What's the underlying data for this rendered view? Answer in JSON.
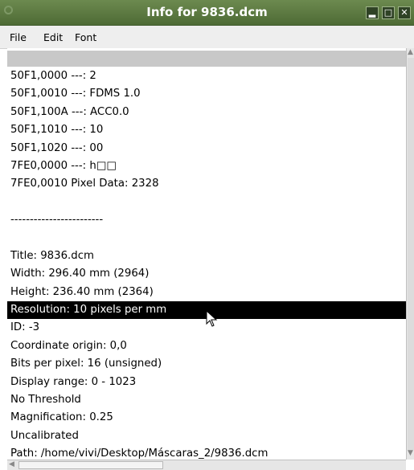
{
  "window": {
    "title": "Info for 9836.dcm"
  },
  "menu": [
    "File",
    "Edit",
    "Font"
  ],
  "lines": [
    "50F1,0000  ---: 2",
    "50F1,0010  ---: FDMS 1.0",
    "50F1,100A  ---: ACC0.0",
    "50F1,1010  ---: 10",
    "50F1,1020  ---: 00",
    "7FE0,0000  ---: h□□",
    "7FE0,0010  Pixel Data: 2328",
    "",
    "------------------------",
    "",
    "Title: 9836.dcm",
    "Width:  296.40 mm (2964)",
    "Height:  236.40 mm (2364)",
    "Resolution:  10 pixels per mm",
    "ID: -3",
    "Coordinate origin:  0,0",
    "Bits per pixel: 16 (unsigned)",
    "Display range: 0 - 1023",
    "No Threshold",
    "Magnification: 0.25",
    "Uncalibrated",
    "Path: /home/vivi/Desktop/Máscaras_2/9836.dcm"
  ],
  "selected_line": "Resolution:  10 pixels per mm",
  "icons": [
    "window-menu-icon",
    "minimize-icon",
    "maximize-icon",
    "close-icon",
    "mouse-cursor-icon"
  ]
}
